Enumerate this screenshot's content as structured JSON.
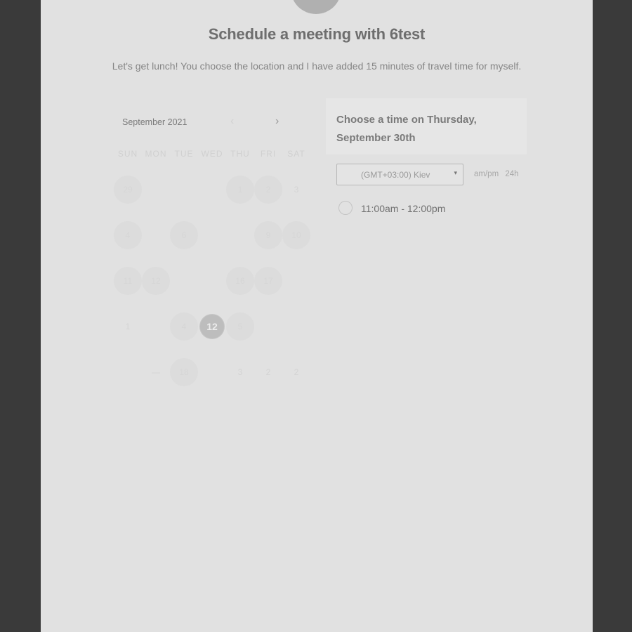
{
  "header": {
    "title": "Schedule a meeting with 6test",
    "subtitle": "Let's get lunch! You choose the location and I have added 15 minutes of travel time for myself."
  },
  "calendar": {
    "month_label": "September 2021",
    "prev_icon": "‹",
    "next_icon": "›",
    "weekdays": [
      "SUN",
      "MON",
      "TUE",
      "WED",
      "THU",
      "FRI",
      "SAT"
    ],
    "days": [
      {
        "label": "29",
        "state": "avail"
      },
      {
        "label": "",
        "state": "empty"
      },
      {
        "label": "",
        "state": "empty"
      },
      {
        "label": "",
        "state": "empty"
      },
      {
        "label": "1",
        "state": "avail"
      },
      {
        "label": "2",
        "state": "avail"
      },
      {
        "label": "3",
        "state": "plain"
      },
      {
        "label": "4",
        "state": "avail"
      },
      {
        "label": "",
        "state": "empty"
      },
      {
        "label": "6",
        "state": "avail"
      },
      {
        "label": "",
        "state": "empty"
      },
      {
        "label": "",
        "state": "empty"
      },
      {
        "label": "9",
        "state": "avail"
      },
      {
        "label": "10",
        "state": "avail"
      },
      {
        "label": "11",
        "state": "avail"
      },
      {
        "label": "12",
        "state": "avail"
      },
      {
        "label": "",
        "state": "empty"
      },
      {
        "label": "",
        "state": "empty"
      },
      {
        "label": "16",
        "state": "avail"
      },
      {
        "label": "17",
        "state": "avail"
      },
      {
        "label": "",
        "state": "empty"
      },
      {
        "label": "1",
        "state": "plain"
      },
      {
        "label": "",
        "state": "empty"
      },
      {
        "label": "4",
        "state": "avail"
      },
      {
        "label": "12",
        "state": "selected"
      },
      {
        "label": "5",
        "state": "avail"
      },
      {
        "label": "",
        "state": "empty"
      },
      {
        "label": "",
        "state": "empty"
      },
      {
        "label": "",
        "state": "empty"
      },
      {
        "label": "—",
        "state": "plain"
      },
      {
        "label": "18",
        "state": "avail"
      },
      {
        "label": "",
        "state": "empty"
      },
      {
        "label": "3",
        "state": "plain"
      },
      {
        "label": "2",
        "state": "plain"
      },
      {
        "label": "2",
        "state": "plain"
      }
    ]
  },
  "time_panel": {
    "heading": "Choose a time on Thursday, September 30th",
    "timezone": "(GMT+03:00) Kiev",
    "caret_icon": "▾",
    "format_ampm": "am/pm",
    "format_24h": "24h",
    "slots": [
      {
        "label": "11:00am - 12:00pm"
      }
    ]
  }
}
